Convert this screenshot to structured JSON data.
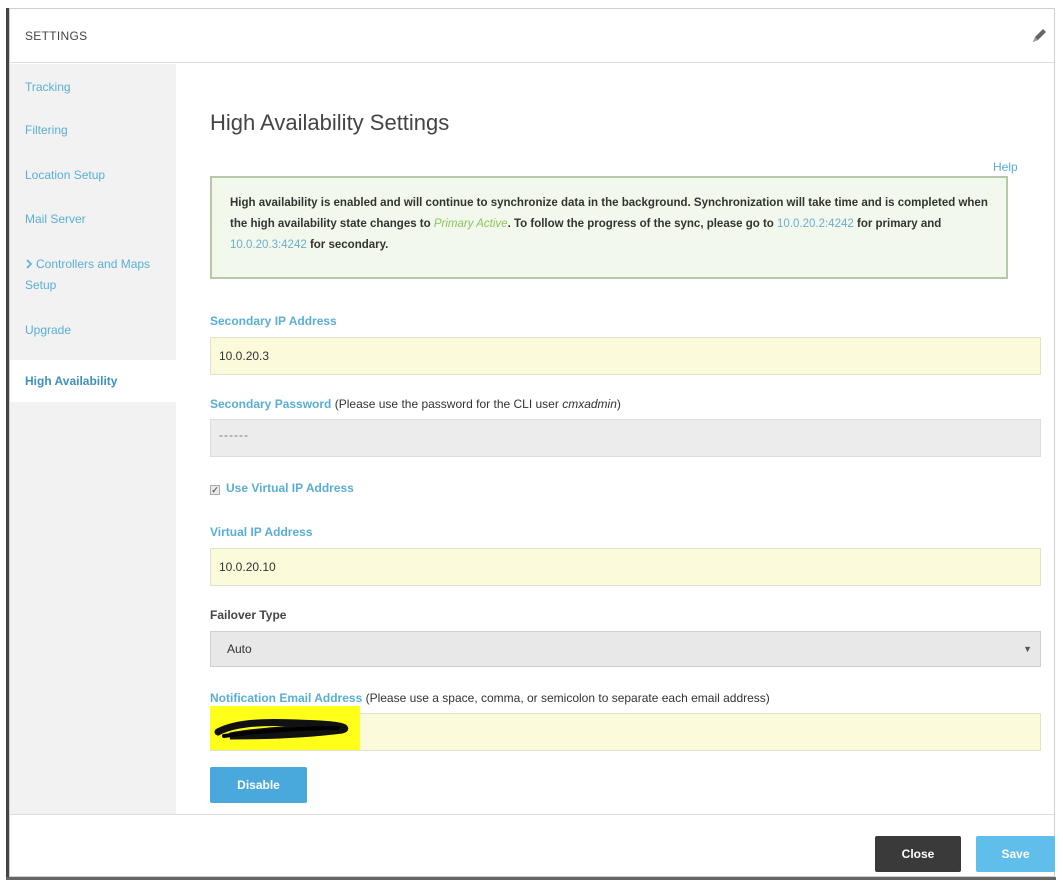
{
  "header": {
    "title": "SETTINGS",
    "edit_icon": "pencil-icon"
  },
  "sidebar": {
    "items": [
      {
        "label": "Tracking"
      },
      {
        "label": "Filtering"
      },
      {
        "label": "Location Setup"
      },
      {
        "label": "Mail Server"
      },
      {
        "label": "Controllers and Maps Setup",
        "icon": "chevron-right-icon"
      },
      {
        "label": "Upgrade"
      },
      {
        "label": "High Availability",
        "active": true
      }
    ]
  },
  "main": {
    "title": "High Availability Settings",
    "help": "Help",
    "info": {
      "text_1": "High availability is enabled and will continue to synchronize data in the background. Synchronization will take time and is completed when the high availability state changes to",
      "state": "Primary Active",
      "text_2": ". To follow the progress of the sync, please go to",
      "primary_link": "10.0.20.2:4242",
      "text_3": "for primary and",
      "secondary_link": "10.0.20.3:4242",
      "text_4": "for secondary."
    },
    "secondary_ip": {
      "label": "Secondary IP Address",
      "value": "10.0.20.3"
    },
    "secondary_password": {
      "label": "Secondary Password",
      "note_prefix": "(Please use the password for the CLI user",
      "note_user": "cmxadmin",
      "note_suffix": ")",
      "value": "------"
    },
    "use_virtual_ip": {
      "label": "Use Virtual IP Address",
      "checked": true
    },
    "virtual_ip": {
      "label": "Virtual IP Address",
      "value": "10.0.20.10"
    },
    "failover_type": {
      "label": "Failover Type",
      "selected": "Auto"
    },
    "notification_email": {
      "label": "Notification Email Address",
      "note": "(Please use a space, comma, or semicolon to separate each email address)",
      "value": ""
    },
    "disable_label": "Disable"
  },
  "footer": {
    "close_label": "Close",
    "save_label": "Save"
  },
  "colors": {
    "accent": "#49a9dc",
    "link": "#5aaed6",
    "input_bg": "#fbfbdc",
    "info_bg": "#f3f8ec",
    "state_green": "#8cc461",
    "close_btn": "#3a3a3a",
    "save_btn": "#5fbeea",
    "highlight": "#ffff1a"
  }
}
